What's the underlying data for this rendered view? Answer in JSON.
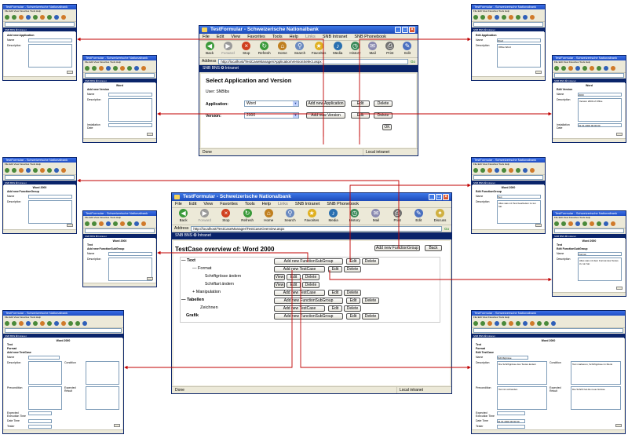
{
  "top_window": {
    "title": "TestFormular - Schweizerische Nationalbank",
    "menu": [
      "File",
      "Edit",
      "View",
      "Favorites",
      "Tools",
      "Help",
      "Links",
      "SNB Intranet",
      "SNB Phonebook"
    ],
    "toolbar": [
      "Back",
      "Forward",
      "Stop",
      "Refresh",
      "Home",
      "Search",
      "Favorites",
      "Media",
      "History",
      "Mail",
      "Print",
      "Edit"
    ],
    "address_label": "Address",
    "url": "http://localhost/TestCaseManager/ApplicationVersionSelect.aspx",
    "go_label": "Go",
    "banner": "SNB BNS ✪ Intranet",
    "heading": "Select Application and Version",
    "user_line": "User: SNBlbs",
    "application_label": "Application:",
    "application_value": "Word",
    "version_label": "Version:",
    "version_value": "2000",
    "add_application": "Add new Application",
    "add_version": "Add new Version",
    "edit": "Edit",
    "delete": "Delete",
    "ok": "OK",
    "status_left": "Done",
    "status_right": "Local intranet"
  },
  "bottom_window": {
    "title": "TestFormular - Schweizerische Nationalbank",
    "menu": [
      "File",
      "Edit",
      "View",
      "Favorites",
      "Tools",
      "Help",
      "Links",
      "SNB Intranet",
      "SNB Phonebook"
    ],
    "toolbar": [
      "Back",
      "Forward",
      "Stop",
      "Refresh",
      "Home",
      "Search",
      "Favorites",
      "Media",
      "History",
      "Mail",
      "Print",
      "Edit",
      "Discuss"
    ],
    "address_label": "Address",
    "url": "http://localhost/TestCaseManager/TestCaseOverview.aspx",
    "go_label": "Go",
    "banner": "SNB BNS ✪ Intranet",
    "heading": "TestCase overview of: Word 2000",
    "add_function_group": "Add new FunctionGroup",
    "back": "Back",
    "add_function_sub_group": "Add new FunctionSubGroup",
    "add_test_case": "Add new TestCase",
    "view": "View",
    "edit": "Edit",
    "delete": "Delete",
    "tree": {
      "text": "Text",
      "format": "Format",
      "schriftgroesse": "Schriftgrösse ändern",
      "schriftart": "Schriftart ändern",
      "manipulation": "Manipulation",
      "tabellen": "Tabellen",
      "zeichnen": "Zeichnen",
      "grafik": "Grafik"
    },
    "status_left": "Done",
    "status_right": "Local intranet"
  },
  "thumbnails": {
    "tl1": {
      "heading": "Add new Application",
      "f1": "Name",
      "f2": "Description"
    },
    "tl2": {
      "center": "Word",
      "heading": "Add new Version",
      "f1": "Name",
      "f2": "Description",
      "f3": "Installation Date"
    },
    "tr1": {
      "heading": "Edit Application",
      "f1": "Name",
      "v1": "Word",
      "f2": "Description",
      "v2": "Office Word"
    },
    "tr2": {
      "center": "Word",
      "heading": "Edit Version",
      "f1": "Name",
      "v1": "2000",
      "f2": "Description",
      "v2": "Version 2000 of Office",
      "f3": "Installation Date",
      "v3": "01.01.2000 00:00:00"
    },
    "ml1": {
      "center": "Word 2000",
      "heading": "Add new FunctionGroup",
      "f1": "Name",
      "f2": "Description"
    },
    "ml2": {
      "center": "Word 2000",
      "sub": "Text",
      "heading": "Add new FunctionSubGroup",
      "f1": "Name",
      "f2": "Description"
    },
    "mr1": {
      "center": "Word 2000",
      "heading": "Edit FunctionGroup",
      "f1": "Name",
      "v1": "Text",
      "f2": "Description",
      "v2": "Alles was mit Text bearbeiten zu tun hat"
    },
    "mr2": {
      "center": "Word 2000",
      "sub": "Text",
      "heading": "Edit FunctionSubGroup",
      "f1": "Name",
      "v1": "Format",
      "f2": "Description",
      "v2": "Alles was mit dem Format des Textes zu tun hat"
    },
    "bl": {
      "center": "Word 2000",
      "sub1": "Text",
      "sub2": "Format",
      "heading": "Add new TestCase",
      "f1": "Name",
      "f2": "Description",
      "f3": "Condition",
      "f4": "Precondition",
      "f5": "Expected Result",
      "f6": "Expected Execution Time",
      "f7": "Date Time",
      "f8": "Tester"
    },
    "br": {
      "center": "Word 2000",
      "sub1": "Text",
      "sub2": "Format",
      "heading": "Edit TestCase",
      "f1": "Name",
      "v1": "Schriftgrösse",
      "f2": "Description",
      "v2": "Die Schriftgrösse des Textes ändern",
      "f3": "Condition",
      "v3": "Text markieren, Schriftgrösse im Menü",
      "f4": "Precondition",
      "v4": "Text ist vorhanden",
      "f5": "Expected Result",
      "v5": "Die Schrift hat die neue Grösse",
      "f6": "Expected Execution Time",
      "f7": "Date Time",
      "v7": "01.01.2000 00:00:00",
      "f8": "Tester"
    }
  },
  "thumb_title": "TestFormular - Schweizerische Nationalbank",
  "thumb_menu": "File  Edit  View  Favorites  Tools  Help",
  "thumb_banner": "SNB BNS ✪ Intranet",
  "colors": {
    "arrow": "#c00000",
    "titlebar": "#1f4ec4",
    "banner": "#0a246a"
  }
}
